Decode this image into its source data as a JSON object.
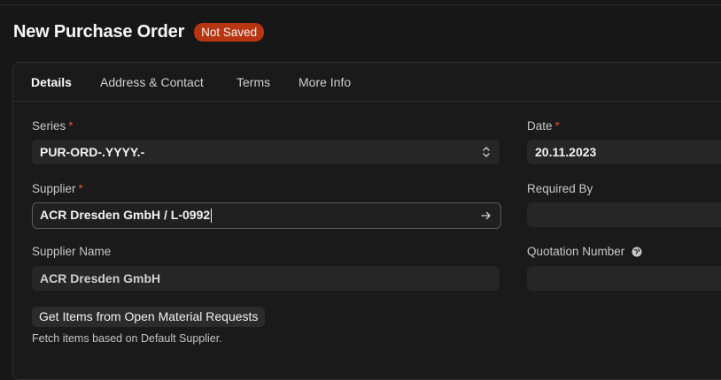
{
  "header": {
    "title": "New Purchase Order",
    "status": "Not Saved"
  },
  "tabs": [
    {
      "label": "Details",
      "active": true
    },
    {
      "label": "Address & Contact"
    },
    {
      "label": "Terms"
    },
    {
      "label": "More Info"
    }
  ],
  "form": {
    "series": {
      "label": "Series",
      "required": "*",
      "value": "PUR-ORD-.YYYY.-"
    },
    "date": {
      "label": "Date",
      "required": "*",
      "value": "20.11.2023"
    },
    "supplier": {
      "label": "Supplier",
      "required": "*",
      "value": "ACR Dresden GmbH / L-0992"
    },
    "required_by": {
      "label": "Required By",
      "value": ""
    },
    "supplier_name": {
      "label": "Supplier Name",
      "value": "ACR Dresden GmbH"
    },
    "quotation_number": {
      "label": "Quotation Number",
      "value": ""
    }
  },
  "actions": {
    "get_items_label": "Get Items from Open Material Requests",
    "help_text": "Fetch items based on Default Supplier."
  },
  "colors": {
    "background": "#171717",
    "badge": "#b83511",
    "required": "#e24c3a",
    "field": "#262626"
  },
  "icons": {
    "series_select": "up-down-chevron-icon",
    "supplier_link": "arrow-right-icon",
    "quotation_info": "globe-icon"
  }
}
